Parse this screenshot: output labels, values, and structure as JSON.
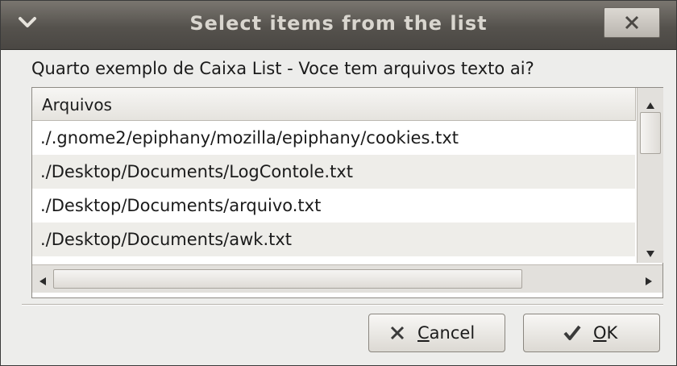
{
  "window": {
    "title": "Select items from the list",
    "menu_icon": "chevron-down-icon",
    "close_icon": "close-icon"
  },
  "dialog": {
    "prompt": "Quarto exemplo de Caixa List - Voce tem arquivos texto ai?"
  },
  "list": {
    "column_header": "Arquivos",
    "rows": [
      "./.gnome2/epiphany/mozilla/epiphany/cookies.txt",
      "./Desktop/Documents/LogContole.txt",
      "./Desktop/Documents/arquivo.txt",
      "./Desktop/Documents/awk.txt"
    ]
  },
  "buttons": {
    "cancel": {
      "mnemonic": "C",
      "rest": "ancel",
      "icon": "close-icon"
    },
    "ok": {
      "mnemonic": "O",
      "rest": "K",
      "icon": "checkmark-icon"
    }
  },
  "colors": {
    "titlebar": "#55524d",
    "title_text": "#d9d6cf",
    "row_alt": "#eeede9",
    "dialog_bg": "#ededeb"
  }
}
